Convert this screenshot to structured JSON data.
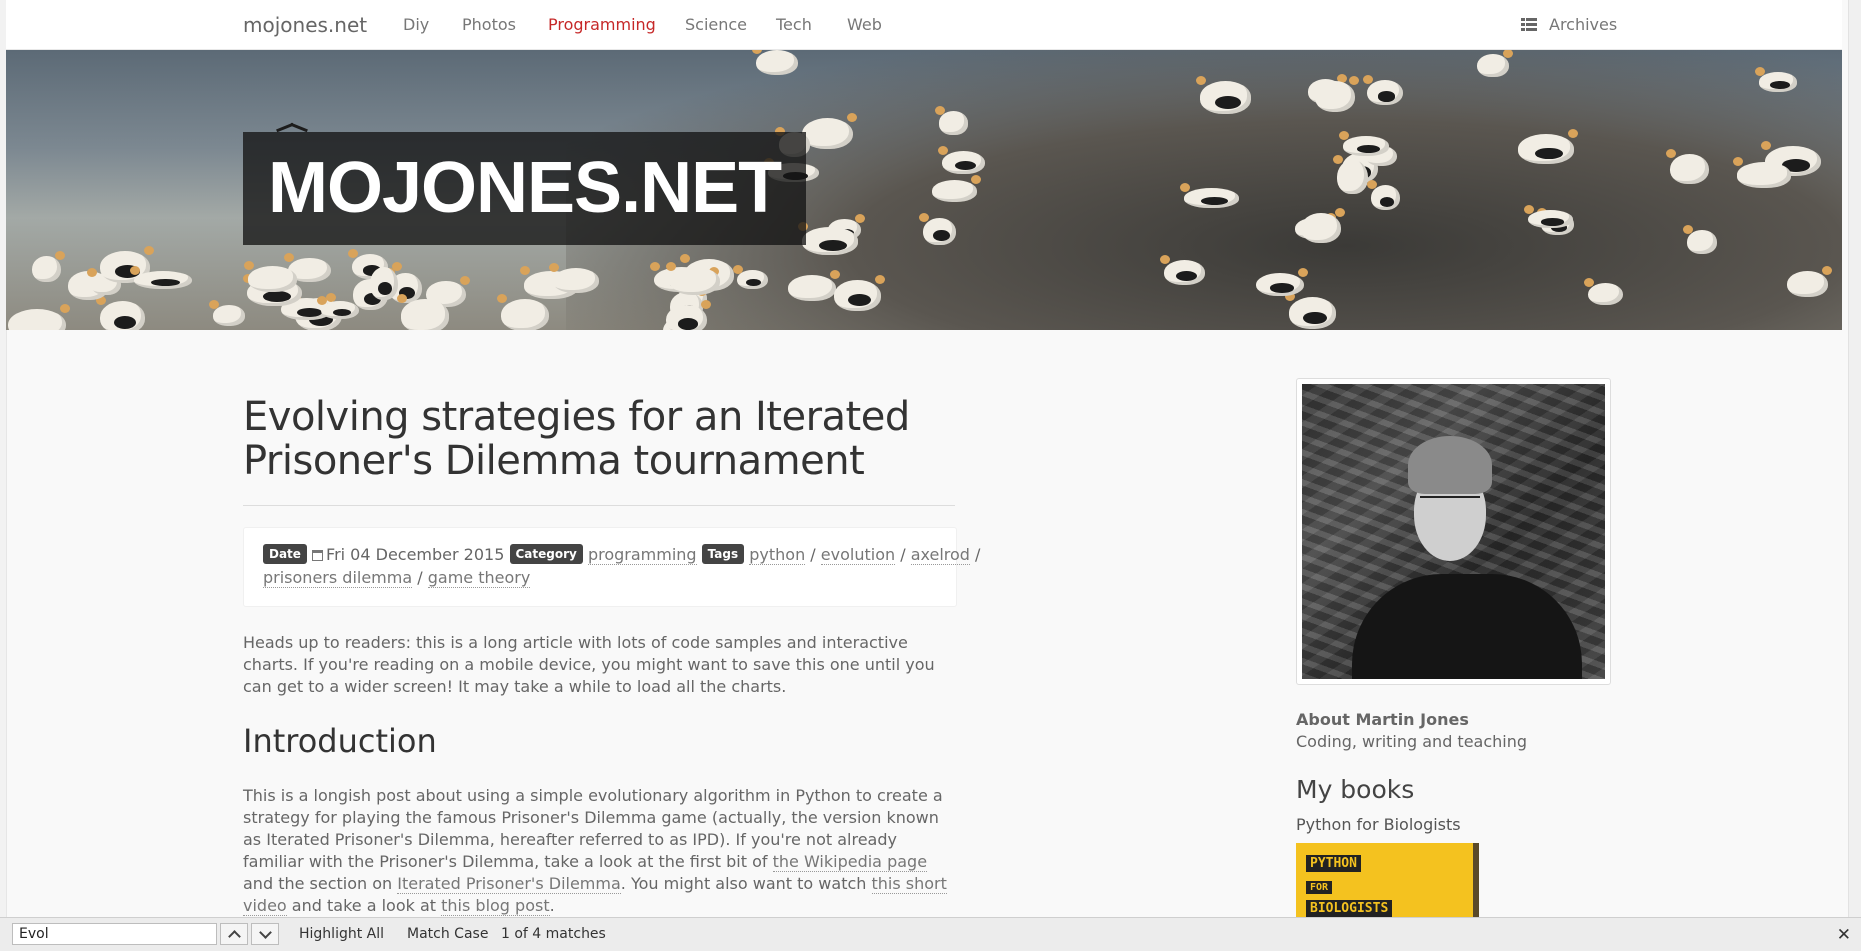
{
  "nav": {
    "brand": "mojones.net",
    "items": [
      "Diy",
      "Photos",
      "Programming",
      "Science",
      "Tech",
      "Web"
    ],
    "active": "Programming",
    "archives": "Archives",
    "active_color": "#c62828"
  },
  "banner": {
    "title": "MOJONES.NET"
  },
  "post": {
    "title": "Evolving strategies for an Iterated Prisoner's Dilemma tournament",
    "meta": {
      "date_label": "Date",
      "date": "Fri 04 December 2015",
      "category_label": "Category",
      "category": "programming",
      "tags_label": "Tags",
      "tags": [
        "python",
        "evolution",
        "axelrod",
        "prisoners dilemma",
        "game theory"
      ],
      "separator": "/"
    },
    "intro_para": "Heads up to readers: this is a long article with lots of code samples and interactive charts. If you're reading on a mobile device, you might want to save this one until you can get to a wider screen! It may take a while to load all the charts.",
    "section_heading": "Introduction",
    "body": {
      "p1": "This is a longish post about using a simple evolutionary algorithm in Python to create a strategy for playing the famous Prisoner's Dilemma game (actually, the version known as Iterated Prisoner's Dilemma, hereafter referred to as IPD). If you're not already familiar with the Prisoner's Dilemma, take a look at the first bit of",
      "link1": "the Wikipedia page",
      "p2": "and the section on",
      "link2": "Iterated Prisoner's Dilemma",
      "p3": ". You might also want to watch",
      "link3": "this short video",
      "p4": "and take a look at",
      "link4": "this blog post",
      "p5": "."
    }
  },
  "sidebar": {
    "about_heading": "About Martin Jones",
    "about_text": "Coding, writing and teaching",
    "books_heading": "My books",
    "book_title": "Python for Biologists",
    "cover_lines": [
      "PYTHON",
      "FOR",
      "BIOLOGISTS"
    ]
  },
  "findbar": {
    "query": "Evol",
    "highlight_all": "Highlight All",
    "match_case": "Match Case",
    "status": "1 of 4 matches"
  }
}
